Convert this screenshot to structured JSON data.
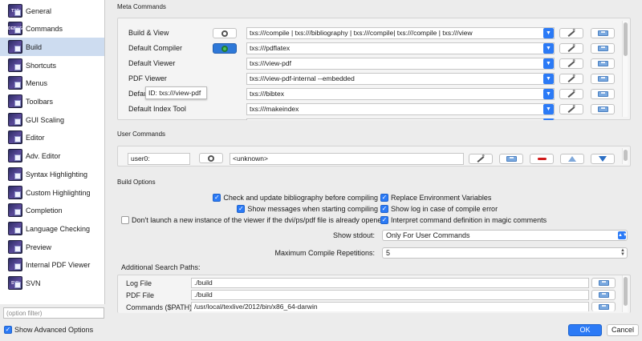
{
  "sidebar": {
    "items": [
      {
        "label": "General",
        "icon": "txs-general-icon",
        "badge": "TXS"
      },
      {
        "label": "Commands",
        "icon": "txs-commands-icon",
        "badge": "DEBUG"
      },
      {
        "label": "Build",
        "icon": "build-icon",
        "badge": ""
      },
      {
        "label": "Shortcuts",
        "icon": "shortcuts-icon",
        "badge": ""
      },
      {
        "label": "Menus",
        "icon": "menus-icon",
        "badge": ""
      },
      {
        "label": "Toolbars",
        "icon": "toolbars-icon",
        "badge": ""
      },
      {
        "label": "GUI Scaling",
        "icon": "gui-scaling-icon",
        "badge": ""
      },
      {
        "label": "Editor",
        "icon": "editor-icon",
        "badge": ""
      },
      {
        "label": "Adv. Editor",
        "icon": "adv-editor-icon",
        "badge": ""
      },
      {
        "label": "Syntax Highlighting",
        "icon": "syntax-highlighting-icon",
        "badge": ""
      },
      {
        "label": "Custom Highlighting",
        "icon": "custom-highlighting-icon",
        "badge": ""
      },
      {
        "label": "Completion",
        "icon": "completion-icon",
        "badge": ""
      },
      {
        "label": "Language Checking",
        "icon": "language-checking-icon",
        "badge": ""
      },
      {
        "label": "Preview",
        "icon": "preview-icon",
        "badge": ""
      },
      {
        "label": "Internal PDF Viewer",
        "icon": "internal-pdf-viewer-icon",
        "badge": ""
      },
      {
        "label": "SVN",
        "icon": "svn-icon",
        "badge": "SVN"
      }
    ],
    "filter_placeholder": "(option filter)",
    "show_advanced": "Show Advanced Options"
  },
  "meta": {
    "title": "Meta Commands",
    "rows": [
      {
        "label": "Build & View",
        "value": "txs:///compile | txs:///bibliography | txs:///compile| txs:///compile | txs:///view"
      },
      {
        "label": "Default Compiler",
        "value": "txs:///pdflatex"
      },
      {
        "label": "Default Viewer",
        "value": "txs:///view-pdf"
      },
      {
        "label": "PDF Viewer",
        "value": "txs:///view-pdf-internal --embedded"
      },
      {
        "label": "Defaul",
        "value": "txs:///bibtex"
      },
      {
        "label": "Default Index Tool",
        "value": "txs:///makeindex"
      }
    ],
    "tooltip": "ID: txs:///view-pdf"
  },
  "user_commands": {
    "title": "User Commands",
    "name": "user0:",
    "value": "<unknown>"
  },
  "build_options": {
    "title": "Build Options",
    "check_bib": "Check and update bibliography before compiling",
    "replace_env": "Replace Environment Variables",
    "show_messages": "Show messages when starting compiling",
    "show_log": "Show log in case of compile error",
    "dont_launch": "Don't launch a new instance of the viewer if the dvi/ps/pdf file is already opened",
    "interpret": "Interpret command definition in magic comments",
    "stdout_label": "Show stdout:",
    "stdout_value": "For User Commands",
    "stdout_prefix": "Only",
    "reps_label": "Maximum Compile Repetitions:",
    "reps_value": "5"
  },
  "search_paths": {
    "title": "Additional Search Paths:",
    "rows": [
      {
        "label": "Log File",
        "value": "./build"
      },
      {
        "label": "PDF File",
        "value": "./build"
      },
      {
        "label": "Commands ($PATH)",
        "value": "/usr/local/texlive/2012/bin/x86_64-darwin"
      }
    ]
  },
  "buttons": {
    "ok": "OK",
    "cancel": "Cancel"
  },
  "colors": {
    "accent": "#2b7af6",
    "selected_row": "#cddcf0",
    "remove": "#d01a1a"
  }
}
